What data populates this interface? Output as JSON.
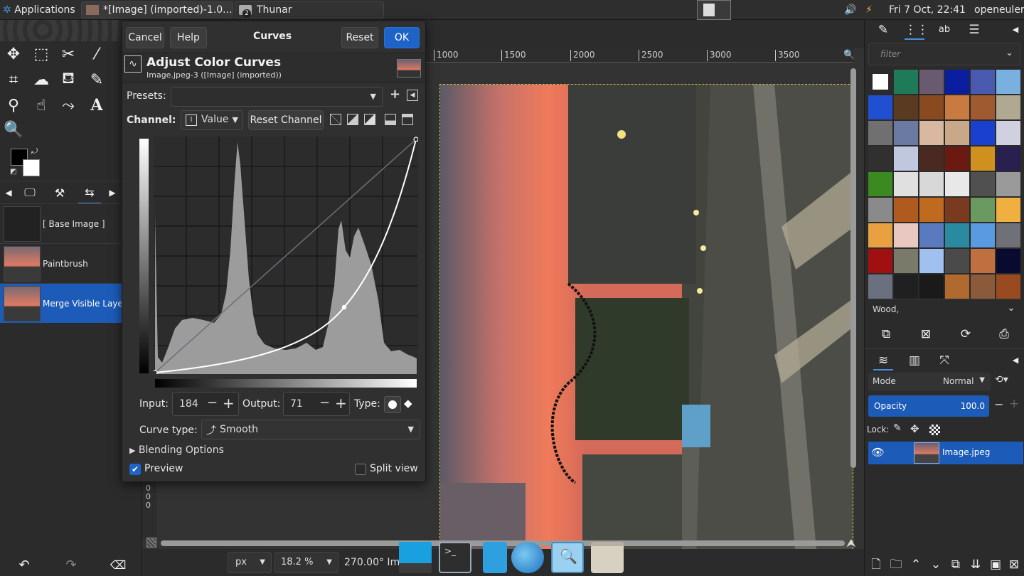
{
  "topbar": {
    "applications": "Applications",
    "task_gimp": "*[Image] (imported)-1.0...",
    "task_thunar": "Thunar",
    "task_thunar_badge": "2",
    "clock": "Fri  7 Oct, 22:41",
    "user": "openeuler"
  },
  "undo_history": {
    "items": [
      {
        "label": "[ Base Image ]"
      },
      {
        "label": "Paintbrush"
      },
      {
        "label": "Merge Visible Layers"
      }
    ]
  },
  "ruler": {
    "ticks": [
      "1000",
      "1500",
      "2000",
      "2500",
      "3000",
      "3500"
    ],
    "left_ticks": [
      "0",
      "0",
      "0"
    ]
  },
  "curves_dialog": {
    "cancel": "Cancel",
    "help": "Help",
    "title": "Curves",
    "reset": "Reset",
    "ok": "OK",
    "heading": "Adjust Color Curves",
    "subheading": "Image.jpeg-3 ([Image] (imported))",
    "presets_label": "Presets:",
    "channel_label": "Channel:",
    "channel_value": "Value",
    "channel_glyph": "I",
    "reset_channel": "Reset Channel",
    "input_label": "Input:",
    "input_value": "184",
    "output_label": "Output:",
    "output_value": "71",
    "type_label": "Type:",
    "curve_type_label": "Curve type:",
    "curve_type_value": "Smooth",
    "blending_options": "Blending Options",
    "preview_label": "Preview",
    "preview_checked": true,
    "split_view_label": "Split view",
    "split_view_checked": false
  },
  "patterns": {
    "filter_placeholder": "filter",
    "selected_name": "Wood,"
  },
  "layers": {
    "mode_label": "Mode",
    "mode_value": "Normal",
    "opacity_label": "Opacity",
    "opacity_value": "100.0",
    "lock_label": "Lock:",
    "layer_name": "Image.jpeg"
  },
  "statusbar": {
    "unit": "px",
    "zoom": "18.2 %",
    "rotation": "270.00° Im"
  },
  "colors": {
    "accent": "#1e63c7",
    "selection": "#1d5bb8"
  }
}
